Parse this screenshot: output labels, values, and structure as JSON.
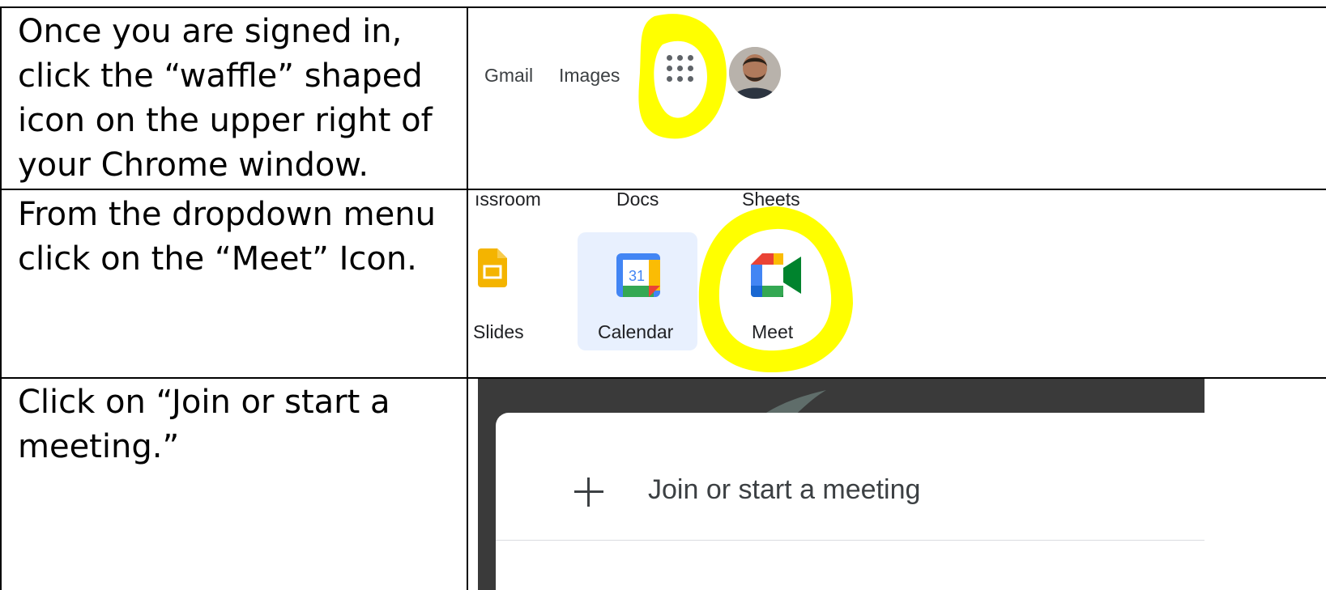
{
  "steps": [
    {
      "text": "Once you are signed in, click the “waffle” shaped icon on the upper right of your Chrome window."
    },
    {
      "text": "From the dropdown menu click on the “Meet” Icon."
    },
    {
      "text": "Click on “Join or start a meeting.”"
    }
  ],
  "shot1": {
    "links": [
      "Gmail",
      "Images"
    ],
    "icons": [
      "apps-waffle-icon",
      "account-avatar"
    ],
    "highlight_color": "#ffff00"
  },
  "shot2": {
    "top_row": [
      "ıssroom",
      "Docs",
      "Sheets"
    ],
    "apps": [
      {
        "label": "Slides",
        "icon": "slides-icon"
      },
      {
        "label": "Calendar",
        "icon": "calendar-icon",
        "badge": "31"
      },
      {
        "label": "Meet",
        "icon": "meet-icon"
      }
    ]
  },
  "shot3": {
    "join_label": "Join or start a meeting",
    "icon": "plus-icon"
  }
}
